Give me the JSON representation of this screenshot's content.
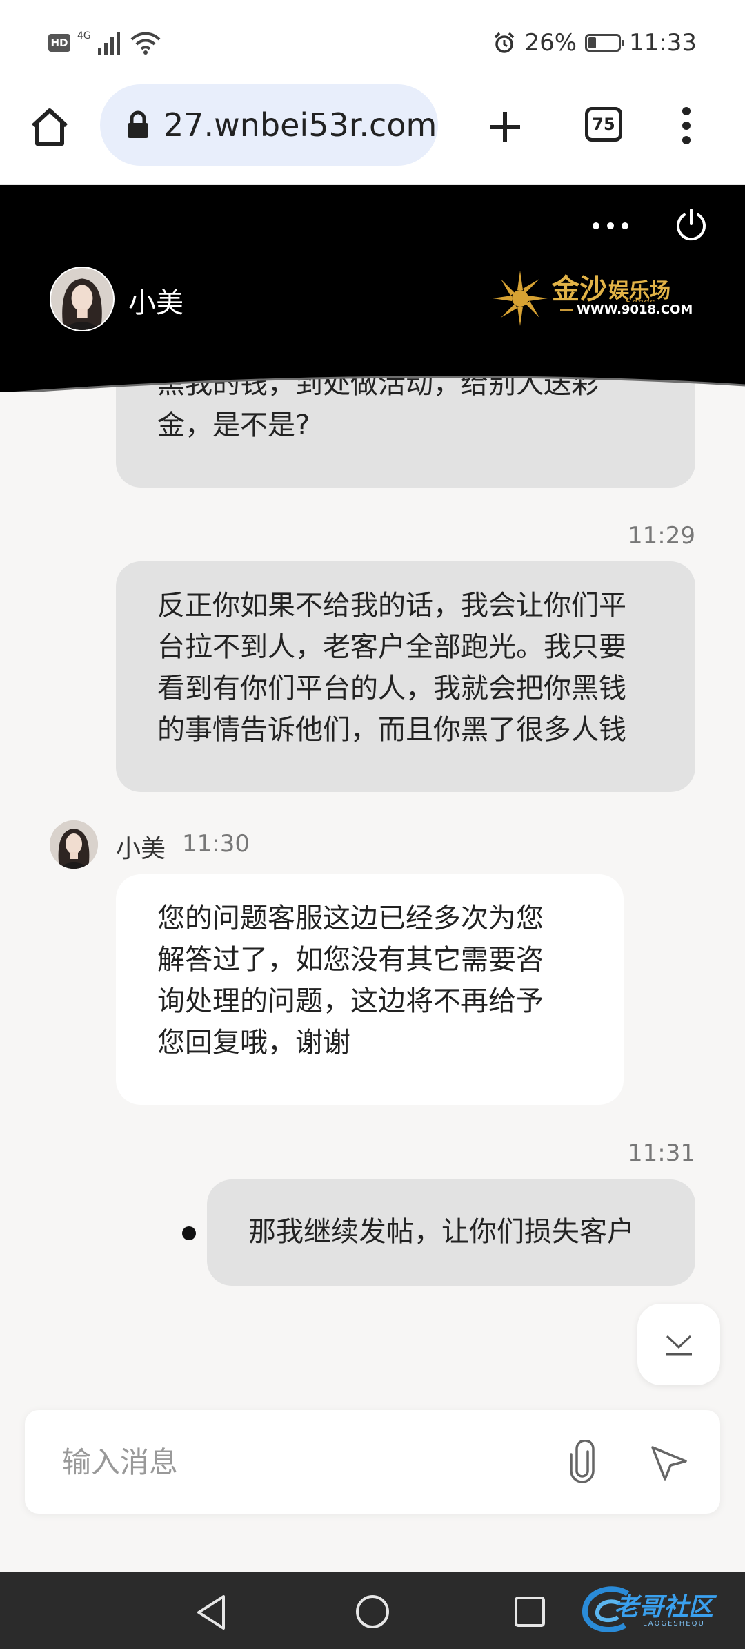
{
  "status_bar": {
    "hd": "HD",
    "network": "4G",
    "battery_percent": "26%",
    "battery_level": 0.26,
    "time": "11:33"
  },
  "browser": {
    "url": "27.wnbei53r.com",
    "tab_count": "75"
  },
  "chat_header": {
    "agent_name": "小美",
    "logo": {
      "brand": "金沙",
      "tagline": "娱乐场",
      "sub": "Sands",
      "site": "WWW.9018.COM"
    }
  },
  "messages": [
    {
      "from": "user",
      "text_lines": [
        "黑我的钱，到处做活动，给别人送彩",
        "金，是不是?"
      ]
    },
    {
      "from": "user",
      "time": "11:29",
      "text_lines": [
        "反正你如果不给我的话，我会让你们平",
        "台拉不到人，老客户全部跑光。我只要",
        "看到有你们平台的人，我就会把你黑钱",
        "的事情告诉他们，而且你黑了很多人钱"
      ]
    },
    {
      "from": "agent",
      "name": "小美",
      "time": "11:30",
      "text_lines": [
        "您的问题客服这边已经多次为您",
        "解答过了，如您没有其它需要咨",
        "询处理的问题，这边将不再给予",
        "您回复哦，谢谢"
      ]
    },
    {
      "from": "user",
      "time": "11:31",
      "text_lines": [
        "那我继续发帖，让你们损失客户"
      ]
    }
  ],
  "composer": {
    "placeholder": "输入消息"
  },
  "watermark": {
    "text": "老哥社区",
    "sub": "LAOGESHEQU"
  },
  "icons": {
    "home": "home-icon",
    "lock": "lock-icon",
    "new_tab": "plus-icon",
    "menu": "more-vert-icon",
    "more": "more-horiz-icon",
    "power": "power-icon",
    "scroll_down": "chevron-down-icon",
    "attach": "paperclip-icon",
    "send": "send-icon"
  }
}
